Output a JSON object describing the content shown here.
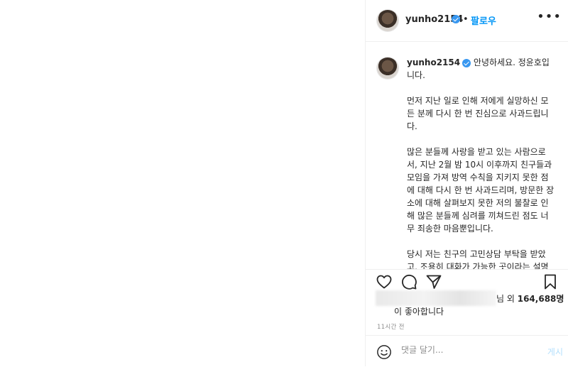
{
  "post": {
    "username": "yunho2154",
    "follow_label": "팔로우",
    "more_label": "•••",
    "separator": "•"
  },
  "caption": {
    "first_line": "안녕하세요. 정윤호입니다.",
    "paragraphs": [
      "먼저 지난 일로 인해 저에게 실망하신 모든 분께 다시 한 번 진심으로 사과드립니다.",
      "많은 분들께 사랑을 받고 있는 사람으로서, 지난 2월 밤 10시 이후까지 친구들과 모임을 가져 방역 수칙을 지키지 못한 점에 대해 다시 한 번 사과드리며, 방문한 장소에 대해 살펴보지 못한 저의 불찰로 인해 많은 분들께 심려를 끼쳐드린 점도 너무 죄송한 마음뿐입니다.",
      "당시 저는 친구의 고민상담 부탁을 받았고, 조용히 대화가 가능한 곳이라는 설명만 듣고 나갔기에 특별히 경각심"
    ]
  },
  "likes": {
    "suffix_prefix": "님 외",
    "count": "164,688명",
    "line2": "이 좋아합니다"
  },
  "time_ago": "11시간 전",
  "comment": {
    "placeholder": "댓글 달기...",
    "post_label": "게시"
  },
  "icons": {
    "like": "heart-icon",
    "comment": "comment-icon",
    "share": "send-icon",
    "save": "bookmark-icon",
    "emoji": "smiley-icon",
    "verified": "verified-badge-icon"
  },
  "colors": {
    "accent": "#0095f6",
    "verified": "#3897f0",
    "muted": "#8e8e8e",
    "post_disabled": "#b2dffc"
  }
}
